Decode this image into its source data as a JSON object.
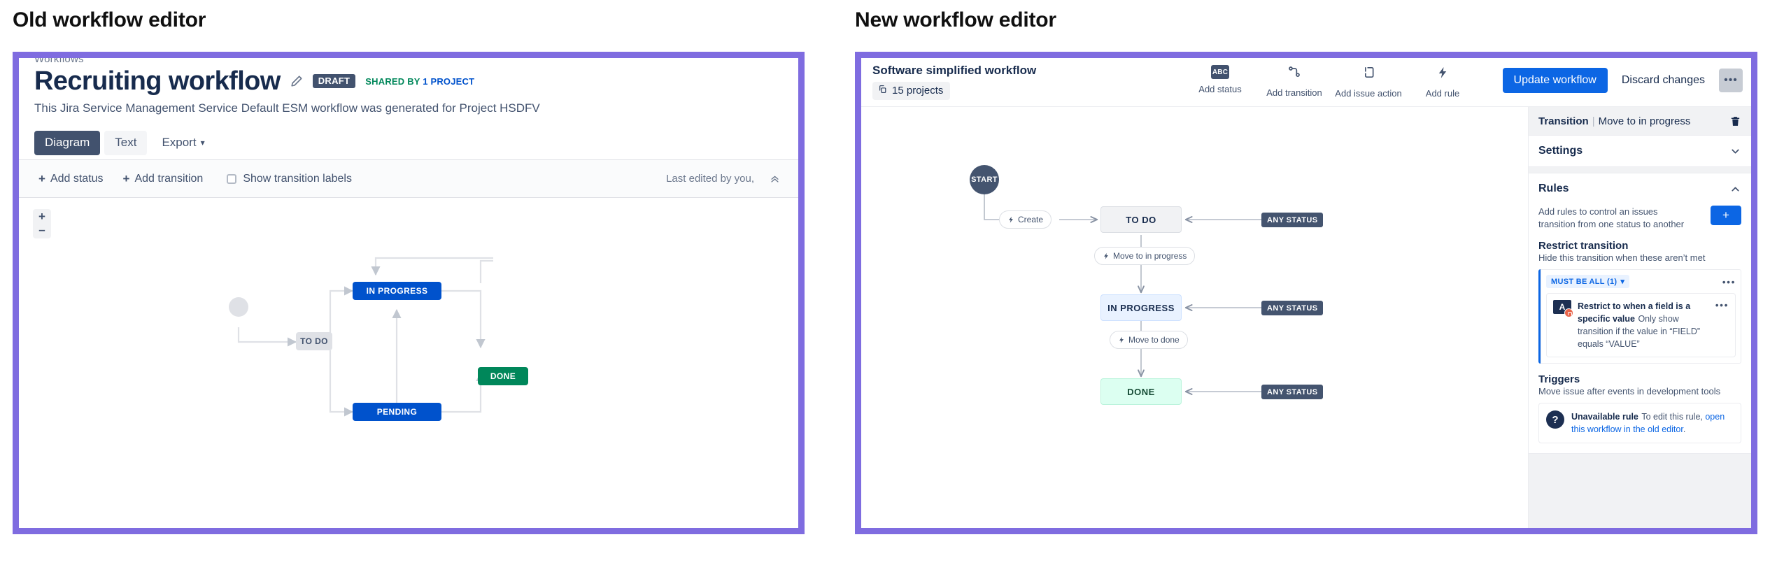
{
  "headings": {
    "old": "Old workflow editor",
    "new": "New workflow editor"
  },
  "colors": {
    "frame_purple": "#7f6ce0",
    "primary_blue": "#0c66e4",
    "old_blue": "#0052cc",
    "green": "#00875a",
    "dark_navy": "#44546f"
  },
  "old_editor": {
    "breadcrumb": "Workflows",
    "title": "Recruiting workflow",
    "edit_icon": "pencil-icon",
    "draft_badge": "DRAFT",
    "shared_prefix": "SHARED BY ",
    "shared_link": "1 PROJECT",
    "description": "This Jira Service Management Service Default ESM workflow was generated for Project HSDFV",
    "tabs": [
      {
        "label": "Diagram",
        "active": true
      },
      {
        "label": "Text",
        "active": false
      }
    ],
    "export_label": "Export",
    "export_caret": "chevron-down-icon",
    "toolbar": {
      "add_status": "Add status",
      "add_transition": "Add transition",
      "show_labels": "Show transition labels",
      "show_labels_checked": false,
      "last_edited": "Last edited by you,",
      "collapse_icon": "double-chevron-up-icon"
    },
    "zoom": {
      "in": "+",
      "out": "–"
    },
    "diagram": {
      "start_node": "start-circle",
      "nodes": [
        {
          "label": "TO DO",
          "style": "grey"
        },
        {
          "label": "IN PROGRESS",
          "style": "blue"
        },
        {
          "label": "PENDING",
          "style": "blue"
        },
        {
          "label": "DONE",
          "style": "green"
        }
      ]
    }
  },
  "new_editor": {
    "workflow_name": "Software simplified workflow",
    "projects_badge": "15 projects",
    "projects_icon": "copy-icon",
    "tools": [
      {
        "label": "Add status",
        "icon": "abc-icon",
        "glyph": "ABC"
      },
      {
        "label": "Add transition",
        "icon": "transition-icon"
      },
      {
        "label": "Add issue action",
        "icon": "issue-action-icon"
      },
      {
        "label": "Add rule",
        "icon": "bolt-icon"
      }
    ],
    "actions": {
      "update": "Update workflow",
      "discard": "Discard changes",
      "more": "•••"
    },
    "diagram": {
      "start_label": "START",
      "statuses": [
        {
          "label": "TO DO",
          "style": "todo"
        },
        {
          "label": "IN PROGRESS",
          "style": "prog"
        },
        {
          "label": "DONE",
          "style": "done"
        }
      ],
      "transitions": [
        {
          "label": "Create"
        },
        {
          "label": "Move to in progress"
        },
        {
          "label": "Move to done"
        }
      ],
      "any_status_label": "ANY STATUS",
      "any_status_count": 3
    },
    "panel": {
      "kind": "Transition",
      "divider": "|",
      "name": "Move to in progress",
      "delete_icon": "trash-icon",
      "settings": {
        "title": "Settings",
        "expanded": false,
        "caret": "chevron-down-icon"
      },
      "rules": {
        "title": "Rules",
        "expanded": true,
        "caret": "chevron-up-icon",
        "intro": "Add rules to control an issues transition from one status to another",
        "add_button": "+",
        "restrict": {
          "title": "Restrict transition",
          "subtitle": "Hide this transition when these aren’t met",
          "condition_chip": "MUST BE ALL (1)",
          "chip_caret": "chevron-down-icon",
          "group_menu": "•••",
          "items": [
            {
              "icon_glyph": "A",
              "title": "Restrict to when a field is a specific value",
              "description": "Only show transition if the value in “FIELD” equals “VALUE”",
              "menu": "•••"
            }
          ]
        },
        "triggers": {
          "title": "Triggers",
          "subtitle": "Move issue after events in development tools",
          "unavailable": {
            "icon": "question-icon",
            "title": "Unavailable rule",
            "text_before": "To edit this rule, ",
            "link": "open this workflow in the old editor",
            "text_after": "."
          }
        }
      }
    }
  }
}
